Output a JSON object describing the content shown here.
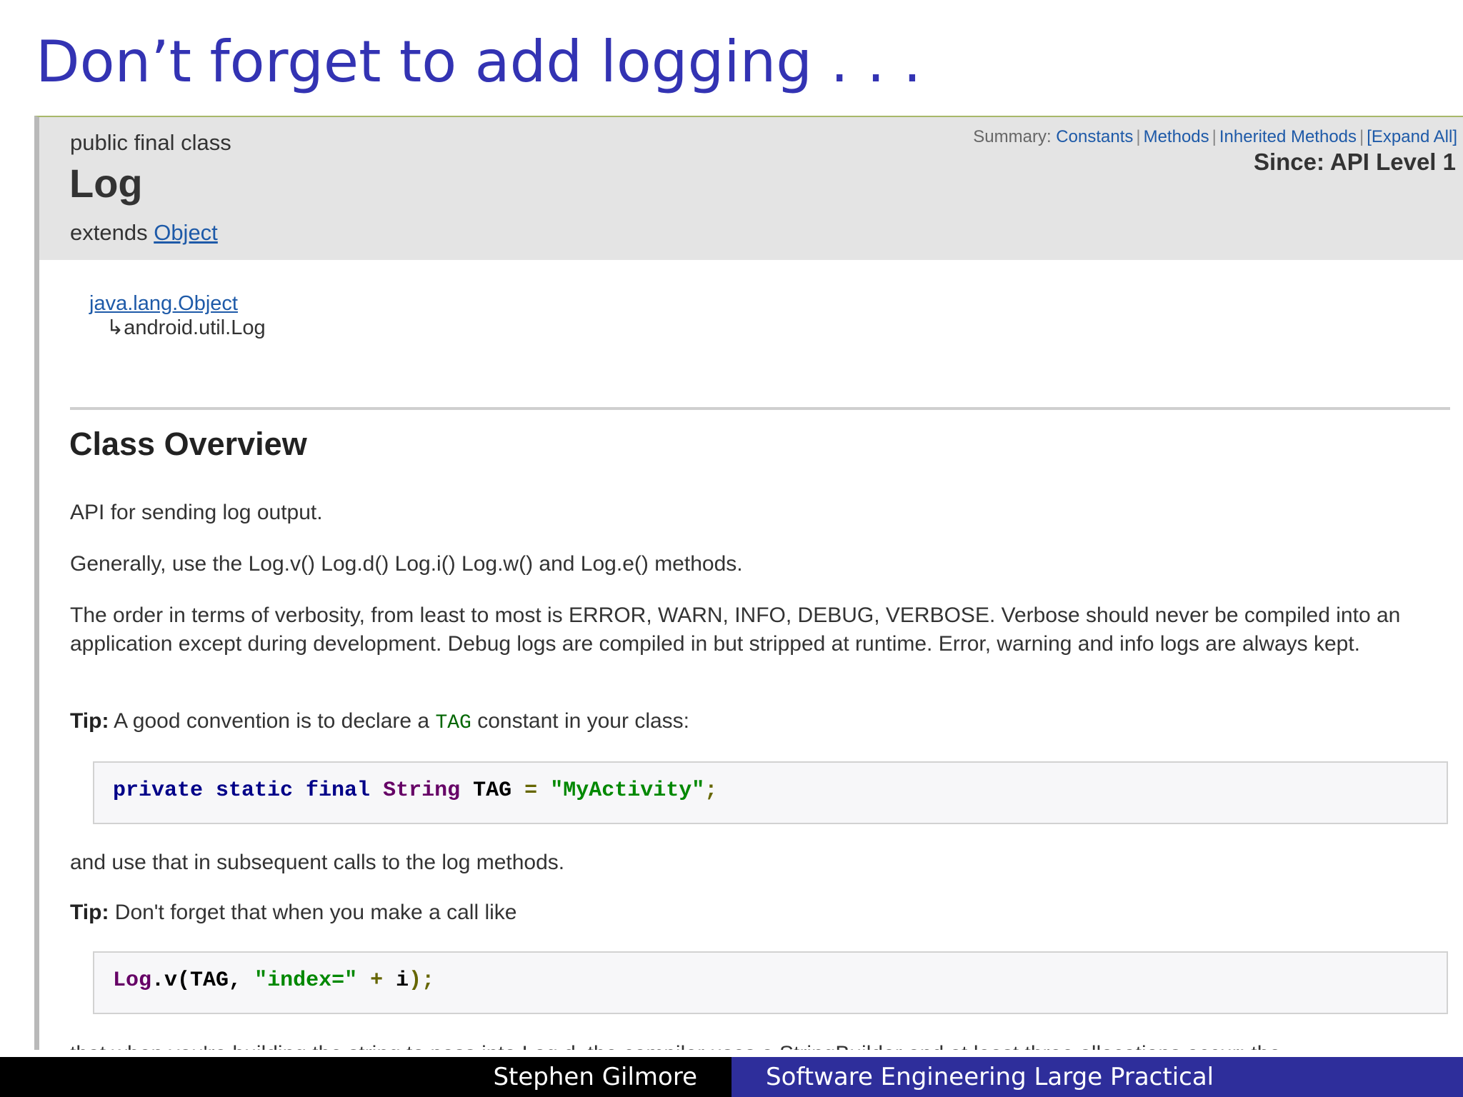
{
  "slide": {
    "title": "Don’t forget to add logging . . .",
    "footer_author": "Stephen Gilmore",
    "footer_course": "Software Engineering Large Practical"
  },
  "doc": {
    "header": {
      "modifiers": "public final class",
      "class_name": "Log",
      "extends_label": "extends ",
      "extends_link": "Object",
      "summary_label": "Summary:",
      "summary_links": [
        "Constants",
        "Methods",
        "Inherited Methods",
        "[Expand All]"
      ],
      "since": "Since: API Level 1"
    },
    "inheritance": {
      "parent": "java.lang.Object",
      "child": "↳android.util.Log"
    },
    "overview_heading": "Class Overview",
    "p1": "API for sending log output.",
    "p2": "Generally, use the Log.v() Log.d() Log.i() Log.w() and Log.e() methods.",
    "p3": "The order in terms of verbosity, from least to most is ERROR, WARN, INFO, DEBUG, VERBOSE. Verbose should never be compiled into an application except during development. Debug logs are compiled in but stripped at runtime. Error, warning and info logs are always kept.",
    "tip_label": "Tip:",
    "tip1_before": " A good convention is to declare a ",
    "tip1_code": "TAG",
    "tip1_after": " constant in your class:",
    "code1": {
      "t1": "private static final",
      "t2": "String",
      "t3": "TAG",
      "t4": "=",
      "t5": "\"MyActivity\"",
      "t6": ";"
    },
    "p4": "and use that in subsequent calls to the log methods.",
    "tip2_text": " Don't forget that when you make a call like",
    "code2": {
      "t1": "Log",
      "t2": ".v(TAG,",
      "t3": "\"index=\"",
      "t4": "+",
      "t5": "i",
      "t6": ");"
    },
    "cut_line": "that when you're building the string to pass into Log.d, the compiler uses a StringBuilder and at least three allocations occur: the"
  }
}
